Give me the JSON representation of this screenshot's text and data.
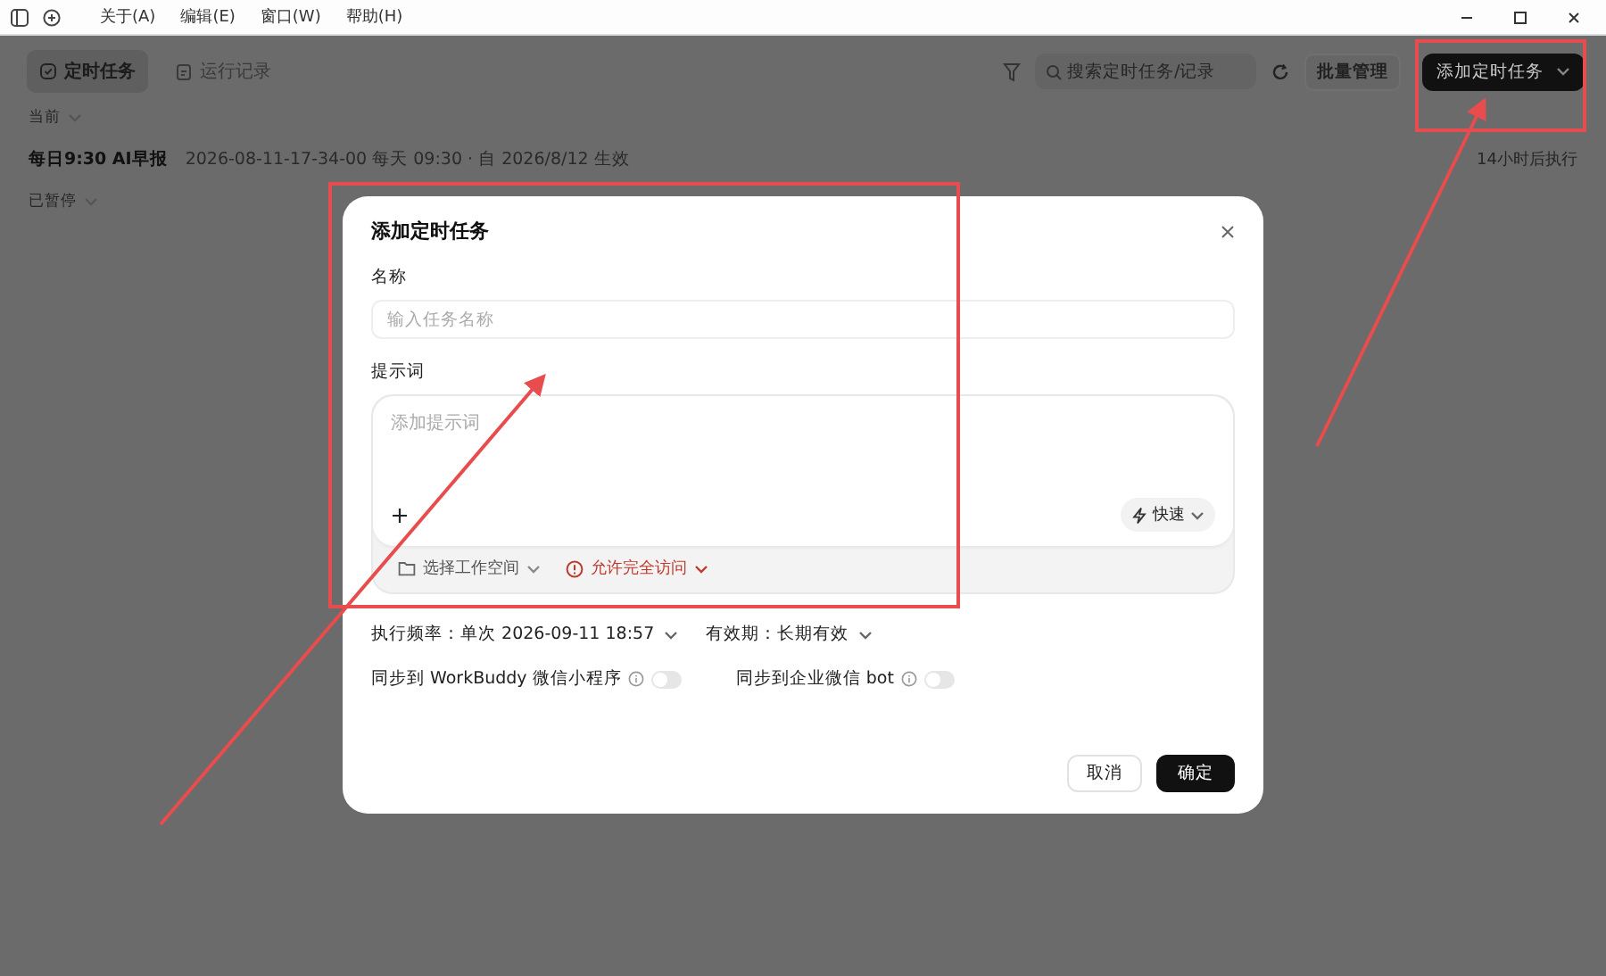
{
  "menu": [
    {
      "label": "关于(A)"
    },
    {
      "label": "编辑(E)"
    },
    {
      "label": "窗口(W)"
    },
    {
      "label": "帮助(H)"
    }
  ],
  "tabs": [
    {
      "label": "定时任务",
      "selected": true,
      "kind": "clock"
    },
    {
      "label": "运行记录",
      "selected": false,
      "kind": "log"
    }
  ],
  "toolbar": {
    "search": {
      "placeholder": "搜索定时任务/记录"
    },
    "batch_button": "批量管理",
    "add_button": "添加定时任务"
  },
  "groups": [
    {
      "label": "当前",
      "tasks": [
        {
          "name": "每日9:30 AI早报",
          "meta": "2026-08-11-17-34-00  每天 09:30 · 自 2026/8/12 生效",
          "next": "14小时后执行"
        }
      ]
    },
    {
      "label": "已暂停"
    }
  ],
  "dialog": {
    "title": "添加定时任务",
    "name_label": "名称",
    "name_placeholder": "输入任务名称",
    "prompt_label": "提示词",
    "prompt_placeholder": "添加提示词",
    "speed": "快速",
    "workspace": "选择工作空间",
    "access": "允许完全访问",
    "frequency": "执行频率：单次 2026-09-11 18:57",
    "validity": "有效期：长期有效",
    "toggles": [
      {
        "label": "同步到 WorkBuddy 微信小程序",
        "on": false
      },
      {
        "label": "同步到企业微信 bot",
        "on": false
      }
    ],
    "cancel": "取消",
    "confirm": "确定"
  }
}
